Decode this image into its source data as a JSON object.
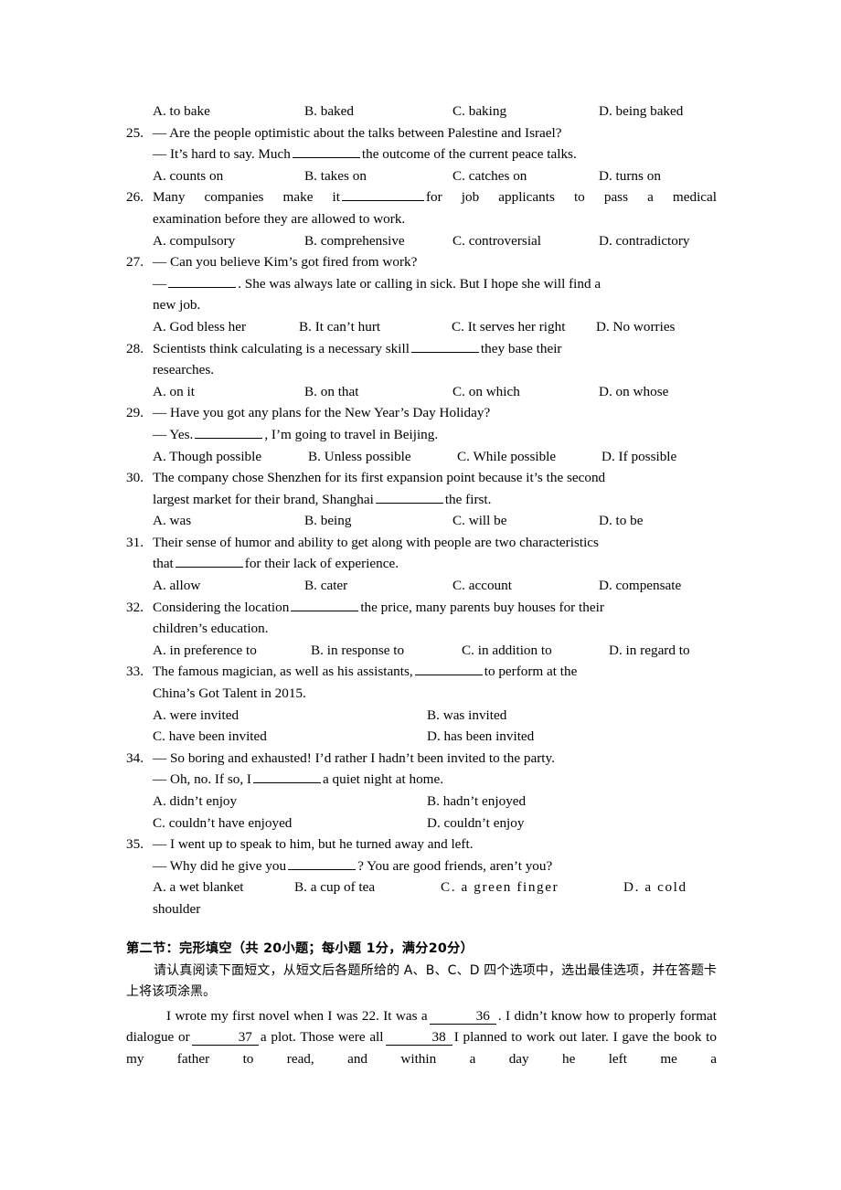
{
  "document": {
    "type": "exam-paper",
    "language": "English grammar exam with Chinese instructions"
  },
  "q24_options": {
    "a": "A. to bake",
    "b": "B. baked",
    "c": "C. baking",
    "d": "D. being baked"
  },
  "questions": [
    {
      "number": "25.",
      "lines": [
        "— Are the people optimistic about the talks between Palestine and Israel?",
        "— It’s hard to say. Much"
      ],
      "line2_tail": "the outcome of the current peace talks.",
      "options": {
        "a": "A. counts on",
        "b": "B. takes on",
        "c": "C. catches on",
        "d": "D. turns on"
      }
    },
    {
      "number": "26.",
      "stem_head": "Many companies make it",
      "stem_tail": "for job applicants to pass a medical",
      "stem_line2": "examination before they are allowed to work.",
      "options": {
        "a": "A. compulsory",
        "b": "B. comprehensive",
        "c": "C. controversial",
        "d": "D. contradictory"
      }
    },
    {
      "number": "27.",
      "line1": "— Can you believe Kim’s got fired from work?",
      "line2_head": "—",
      "line2_tail": ". She was always late or calling in sick. But I hope she will find a",
      "line3": "new job.",
      "options": {
        "a": "A. God bless her",
        "b": "B. It can’t hurt",
        "c": "C. It serves her right",
        "d": "D. No worries"
      }
    },
    {
      "number": "28.",
      "stem_head": "Scientists think calculating is a necessary skill",
      "stem_tail": "they base their",
      "stem_line2": "researches.",
      "options": {
        "a": "A. on it",
        "b": "B. on that",
        "c": "C. on which",
        "d": "D. on whose"
      }
    },
    {
      "number": "29.",
      "line1": "— Have you got any plans for the New Year’s Day Holiday?",
      "line2_head": "— Yes.",
      "line2_tail": ", I’m going to travel in Beijing.",
      "options": {
        "a": "A. Though possible",
        "b": "B. Unless possible",
        "c": "C. While possible",
        "d": "D. If possible"
      }
    },
    {
      "number": "30.",
      "stem_line1": "The company chose Shenzhen for its first expansion point because it’s the second",
      "stem_head": "largest market for their brand, Shanghai",
      "stem_tail": "the first.",
      "options": {
        "a": "A. was",
        "b": "B. being",
        "c": "C. will be",
        "d": "D. to be"
      }
    },
    {
      "number": "31.",
      "stem_line1": "Their sense of humor and ability to get along with people are two characteristics",
      "stem_head": "that",
      "stem_tail": "for their lack of experience.",
      "options": {
        "a": "A. allow",
        "b": "B. cater",
        "c": "C. account",
        "d": "D. compensate"
      }
    },
    {
      "number": "32.",
      "stem_head": "Considering the location",
      "stem_tail": "the price, many parents buy houses for their",
      "stem_line2": "children’s education.",
      "options": {
        "a": "A. in preference to",
        "b": "B. in response to",
        "c": "C. in addition to",
        "d": "D. in regard to"
      }
    },
    {
      "number": "33.",
      "stem_head": "The famous magician, as well as his assistants,",
      "stem_tail": "to perform at the",
      "stem_line2": "China’s Got Talent in 2015.",
      "options": {
        "a": "A. were invited",
        "b": "B. was invited",
        "c": "C. have been invited",
        "d": "D. has been invited"
      }
    },
    {
      "number": "34.",
      "line1": "— So boring and exhausted! I’d rather I hadn’t been invited to the party.",
      "line2_head": "— Oh, no. If so, I",
      "line2_tail": "a quiet night at home.",
      "options": {
        "a": "A. didn’t enjoy",
        "b": "B. hadn’t enjoyed",
        "c": "C. couldn’t have enjoyed",
        "d": "D. couldn’t enjoy"
      }
    },
    {
      "number": "35.",
      "line1": "— I went up to speak to him, but he turned away and left.",
      "line2_head": "— Why did he give you",
      "line2_tail": "? You are good friends, aren’t you?",
      "options": {
        "a": "A. a wet blanket",
        "b": "B. a cup of tea",
        "c": "C.  a  green  finger",
        "d": "D.  a  cold",
        "d_wrap": "shoulder"
      }
    }
  ],
  "section2": {
    "heading": "第二节：完形填空（共 20小题；每小题 1分，满分20分）",
    "instruction": "请认真阅读下面短文，从短文后各题所给的 A、B、C、D 四个选项中，选出最佳选项，并在答题卡上将该项涂黑。",
    "passage": {
      "seg1": "I wrote my first novel when I was 22. It was a",
      "blank36": "36",
      "seg2": ". I didn’t know how to properly format dialogue or",
      "blank37": "37",
      "seg3": "a plot. Those were all",
      "blank38": "38",
      "seg4": "I planned to work out later. I gave the book to my father to read, and within a day he left me a"
    }
  }
}
